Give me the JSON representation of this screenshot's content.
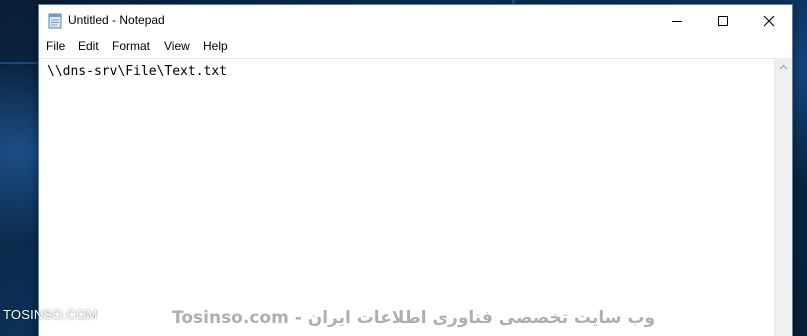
{
  "window": {
    "title": "Untitled - Notepad",
    "app_icon": "notepad-icon",
    "controls": {
      "minimize": "minimize-icon",
      "maximize": "maximize-icon",
      "close": "close-icon"
    }
  },
  "menubar": {
    "items": [
      {
        "label": "File"
      },
      {
        "label": "Edit"
      },
      {
        "label": "Format"
      },
      {
        "label": "View"
      },
      {
        "label": "Help"
      }
    ]
  },
  "editor": {
    "content": "\\\\dns-srv\\File\\Text.txt"
  },
  "scrollbar": {
    "up_arrow": "chevron-up-icon"
  },
  "watermark": {
    "left_text": "TOSINSO.COM",
    "center_text": "Tosinso.com - وب سایت تخصصی فناوری اطلاعات ایران"
  },
  "colors": {
    "desktop_background": "#0d3560",
    "window_border": "#5a7fa8",
    "window_background": "#ffffff"
  }
}
